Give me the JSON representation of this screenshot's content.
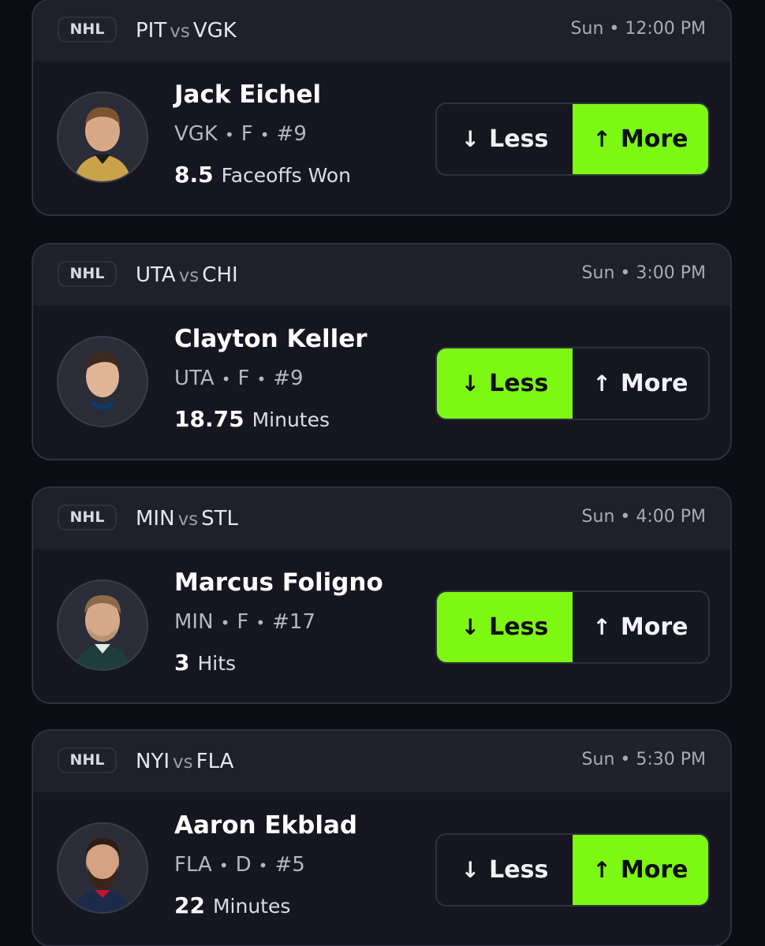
{
  "colors": {
    "background": "#0b0c14",
    "card": "#15161f",
    "header": "#1f2029",
    "selected_accent": "#7cf812"
  },
  "cards": [
    {
      "league": "NHL",
      "team1": "PIT",
      "vs": "vs",
      "team2": "VGK",
      "time": "Sun • 12:00 PM",
      "player_name": "Jack Eichel",
      "team": "VGK",
      "position": "F",
      "number": "#9",
      "line_value": "8.5",
      "stat": "Faceoffs Won",
      "less_label": "Less",
      "more_label": "More",
      "selected": "more",
      "avatar_icon": "player-headshot-icon"
    },
    {
      "league": "NHL",
      "team1": "UTA",
      "vs": "vs",
      "team2": "CHI",
      "time": "Sun • 3:00 PM",
      "player_name": "Clayton Keller",
      "team": "UTA",
      "position": "F",
      "number": "#9",
      "line_value": "18.75",
      "stat": "Minutes",
      "less_label": "Less",
      "more_label": "More",
      "selected": "less",
      "avatar_icon": "player-headshot-icon"
    },
    {
      "league": "NHL",
      "team1": "MIN",
      "vs": "vs",
      "team2": "STL",
      "time": "Sun • 4:00 PM",
      "player_name": "Marcus Foligno",
      "team": "MIN",
      "position": "F",
      "number": "#17",
      "line_value": "3",
      "stat": "Hits",
      "less_label": "Less",
      "more_label": "More",
      "selected": "less",
      "avatar_icon": "player-headshot-icon"
    },
    {
      "league": "NHL",
      "team1": "NYI",
      "vs": "vs",
      "team2": "FLA",
      "time": "Sun • 5:30 PM",
      "player_name": "Aaron Ekblad",
      "team": "FLA",
      "position": "D",
      "number": "#5",
      "line_value": "22",
      "stat": "Minutes",
      "less_label": "Less",
      "more_label": "More",
      "selected": "more",
      "avatar_icon": "player-headshot-icon"
    }
  ]
}
